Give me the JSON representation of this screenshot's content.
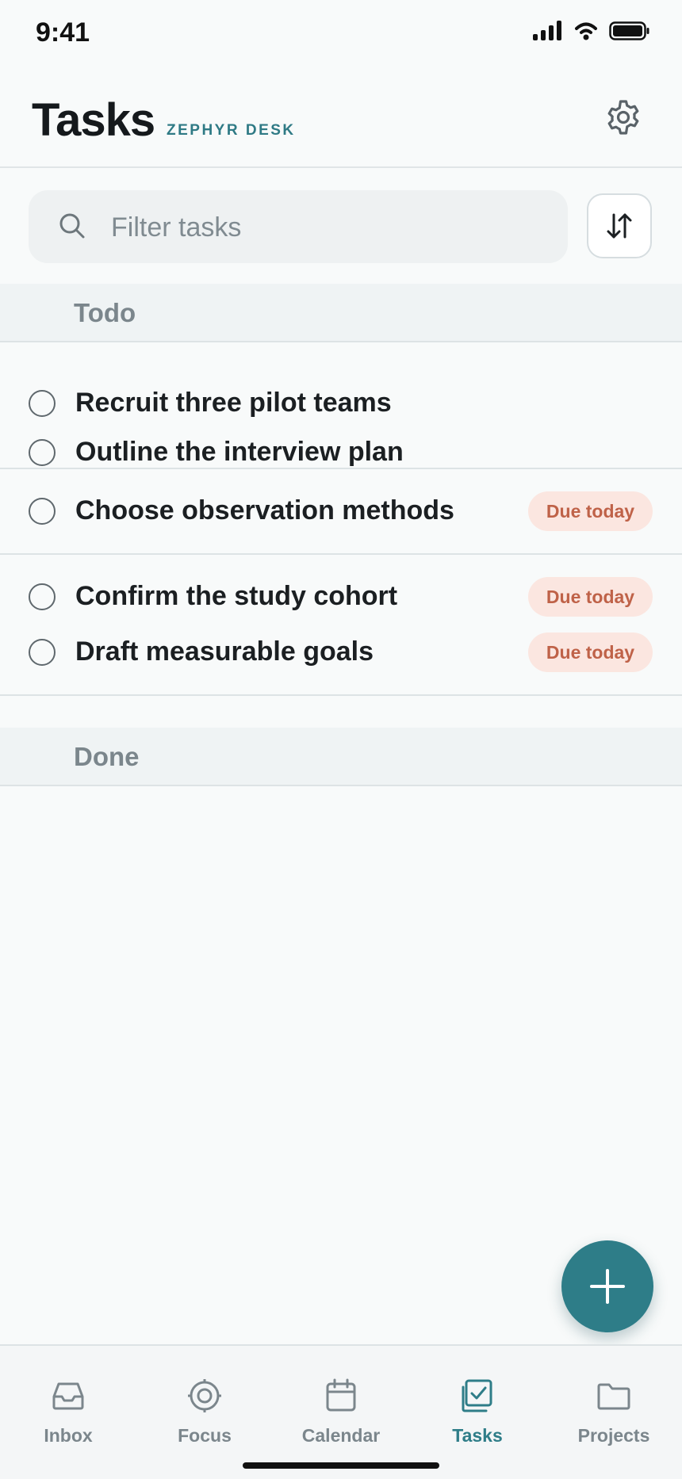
{
  "status_bar": {
    "time": "9:41"
  },
  "header": {
    "title": "Tasks",
    "brand": "ZEPHYR DESK",
    "settings_icon": "gear-icon"
  },
  "search": {
    "placeholder": "Filter tasks",
    "value": "",
    "icon": "search-icon",
    "sort_icon": "sort-arrows-icon"
  },
  "sections": {
    "todo": {
      "title": "Todo",
      "groups": [
        {
          "tasks": [
            {
              "label": "Recruit three pilot teams",
              "badge": ""
            },
            {
              "label": "Outline the interview plan",
              "badge": ""
            }
          ]
        },
        {
          "tasks": [
            {
              "label": "Choose observation methods",
              "badge": "Due today"
            }
          ]
        },
        {
          "tasks": [
            {
              "label": "Confirm the study cohort",
              "badge": "Due today"
            },
            {
              "label": "Draft measurable goals",
              "badge": "Due today"
            }
          ]
        }
      ]
    },
    "done": {
      "title": "Done"
    }
  },
  "fab": {
    "icon": "plus-icon"
  },
  "tab_bar": {
    "active": "Tasks",
    "tabs": [
      {
        "label": "Inbox",
        "icon": "inbox-icon"
      },
      {
        "label": "Focus",
        "icon": "target-icon"
      },
      {
        "label": "Calendar",
        "icon": "calendar-icon"
      },
      {
        "label": "Tasks",
        "icon": "tasks-icon"
      },
      {
        "label": "Projects",
        "icon": "folder-icon"
      }
    ]
  },
  "colors": {
    "accent": "#2e7d88",
    "badge_bg": "#fbe6e0",
    "badge_text": "#bf6248",
    "background": "#f8fafa"
  }
}
